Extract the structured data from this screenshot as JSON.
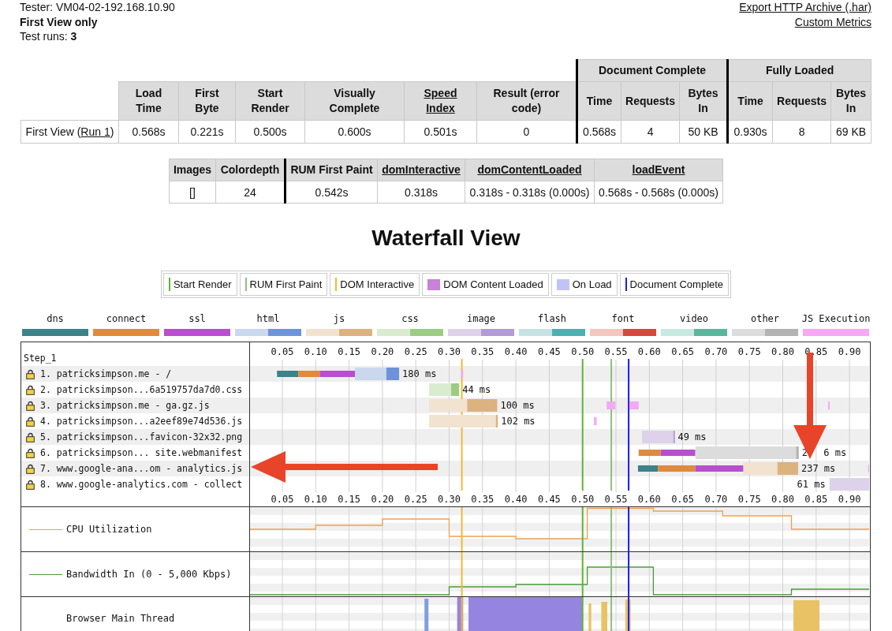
{
  "header": {
    "tester": "Tester: VM04-02-192.168.10.90",
    "view": "First View only",
    "runs": "Test runs: **3**"
  },
  "links": [
    "Export HTTP Archive (.har)",
    "Custom Metrics"
  ],
  "summary_table": {
    "groups": [
      {
        "columns": [
          {
            "label": "Load Time",
            "link": false
          },
          {
            "label": "First Byte",
            "link": false
          },
          {
            "label": "Start Render",
            "link": false
          },
          {
            "label": "Visually Complete",
            "link": false
          },
          {
            "label": "Speed Index",
            "link": true
          },
          {
            "label": "Result (error code)",
            "link": false
          }
        ]
      },
      {
        "label": "Document Complete",
        "columns": [
          {
            "label": "Time",
            "link": false
          },
          {
            "label": "Requests",
            "link": false
          },
          {
            "label": "Bytes In",
            "link": false
          }
        ]
      },
      {
        "label": "Fully Loaded",
        "columns": [
          {
            "label": "Time",
            "link": false
          },
          {
            "label": "Requests",
            "link": false
          },
          {
            "label": "Bytes In",
            "link": false
          }
        ]
      }
    ],
    "rows": [
      {
        "label": "First View (",
        "link": "Run 1",
        "label_end": ")",
        "cells": [
          "0.568s",
          "0.221s",
          "0.500s",
          "0.600s",
          "0.501s",
          "0",
          "0.568s",
          "4",
          "50 KB",
          "0.930s",
          "8",
          "69 KB"
        ]
      }
    ]
  },
  "metrics_table": {
    "columns": [
      {
        "label": "Images",
        "link": false,
        "divider_before": false
      },
      {
        "label": "Colordepth",
        "link": false,
        "divider_before": false
      },
      {
        "label": "RUM First Paint",
        "link": false,
        "divider_before": true
      },
      {
        "label": "domInteractive",
        "link": true,
        "divider_before": false
      },
      {
        "label": "domContentLoaded",
        "link": true,
        "divider_before": false
      },
      {
        "label": "loadEvent",
        "link": true,
        "divider_before": false
      }
    ],
    "rows": [
      {
        "cells": [
          "[]",
          "24",
          "0.542s",
          "0.318s",
          "0.318s - 0.318s (0.000s)",
          "0.568s - 0.568s (0.000s)"
        ]
      }
    ]
  },
  "waterfall_title": "Waterfall View",
  "event_legend": [
    {
      "label": "Start Render",
      "kind": "line",
      "color": "#5cb531"
    },
    {
      "label": "RUM First Paint",
      "kind": "line",
      "color": "#8fbf7a"
    },
    {
      "label": "DOM Interactive",
      "kind": "line",
      "color": "#f5b731"
    },
    {
      "label": "DOM Content Loaded",
      "kind": "box",
      "color": "#c882d8"
    },
    {
      "label": "On Load",
      "kind": "box",
      "color": "#c0c4f5"
    },
    {
      "label": "Document Complete",
      "kind": "line",
      "color": "#1a1aff"
    }
  ],
  "color_legend": [
    {
      "label": "dns",
      "kind": "solid",
      "parts": [
        {
          "color": "#3c8289"
        }
      ]
    },
    {
      "label": "connect",
      "kind": "solid",
      "parts": [
        {
          "color": "#e08a3c"
        }
      ]
    },
    {
      "label": "ssl",
      "kind": "solid",
      "parts": [
        {
          "color": "#b84fcf"
        }
      ]
    },
    {
      "label": "html",
      "kind": "split",
      "parts": [
        {
          "color": "#c9d8ec"
        },
        {
          "color": "#6e93d8"
        }
      ]
    },
    {
      "label": "js",
      "kind": "split",
      "parts": [
        {
          "color": "#f1e3cf"
        },
        {
          "color": "#dcb27f"
        }
      ]
    },
    {
      "label": "css",
      "kind": "split",
      "parts": [
        {
          "color": "#d9ecd0"
        },
        {
          "color": "#9ccc83"
        }
      ]
    },
    {
      "label": "image",
      "kind": "split",
      "parts": [
        {
          "color": "#ddd2ea"
        },
        {
          "color": "#b39bd6"
        }
      ]
    },
    {
      "label": "flash",
      "kind": "split",
      "parts": [
        {
          "color": "#c6e3e4"
        },
        {
          "color": "#4fb0b2"
        }
      ]
    },
    {
      "label": "font",
      "kind": "split",
      "parts": [
        {
          "color": "#f1c7c0"
        },
        {
          "color": "#d4493d"
        }
      ]
    },
    {
      "label": "video",
      "kind": "split",
      "parts": [
        {
          "color": "#c8e9e0"
        },
        {
          "color": "#5bb69c"
        }
      ]
    },
    {
      "label": "other",
      "kind": "split",
      "parts": [
        {
          "color": "#dcdcdc"
        },
        {
          "color": "#b3b3b3"
        }
      ]
    },
    {
      "label": "JS Execution",
      "kind": "solid",
      "parts": [
        {
          "color": "#f5a8f5"
        }
      ]
    }
  ],
  "waterfall": {
    "step": "Step_1",
    "tick_labels": [
      "0.05",
      "0.10",
      "0.15",
      "0.20",
      "0.25",
      "0.30",
      "0.35",
      "0.40",
      "0.45",
      "0.50",
      "0.55",
      "0.60",
      "0.65",
      "0.70",
      "0.75",
      "0.80",
      "0.85",
      "0.90"
    ],
    "requests": [
      {
        "label": "1. patricksimpson.me - /",
        "secure": true,
        "time_label": [
          "180 ms"
        ]
      },
      {
        "label": "2. patricksimpson...6a519757da7d0.css",
        "secure": true,
        "time_label": [
          "44 ms"
        ]
      },
      {
        "label": "3. patricksimpson.me - ga.gz.js",
        "secure": true,
        "time_label": [
          "100 ms"
        ]
      },
      {
        "label": "4. patricksimpson...a2eef89e74d536.js",
        "secure": true,
        "time_label": [
          "102 ms"
        ]
      },
      {
        "label": "5. patricksimpson...favicon-32x32.png",
        "secure": true,
        "time_label": [
          "49 ms"
        ]
      },
      {
        "label": "6. patricksimpson... site.webmanifest",
        "secure": true,
        "time_label": [
          "2",
          "6 ms"
        ]
      },
      {
        "label": "7. www.google-ana...om - analytics.js",
        "secure": true,
        "time_label": [
          "237 ms"
        ]
      },
      {
        "label": "8. www.google-analytics.com - collect",
        "secure": true,
        "time_label": [
          "61 ms"
        ]
      }
    ],
    "bottom_tick_labels": [
      "0.05",
      "0.10",
      "0.15",
      "0.20",
      "0.25",
      "0.30",
      "0.35",
      "0.40",
      "0.45",
      "0.50",
      "0.55",
      "0.60",
      "0.65",
      "0.70",
      "0.75",
      "0.80",
      "0.85",
      "0.90"
    ]
  },
  "graphs": [
    {
      "kind": "cpu",
      "label": "CPU Utilization",
      "color": "#f0a050"
    },
    {
      "kind": "bandwidth",
      "label": "Bandwidth In (0 - 5,000 Kbps)",
      "color": "#4c9a3a"
    },
    {
      "kind": "main_thread",
      "label": "Browser Main Thread"
    }
  ]
}
